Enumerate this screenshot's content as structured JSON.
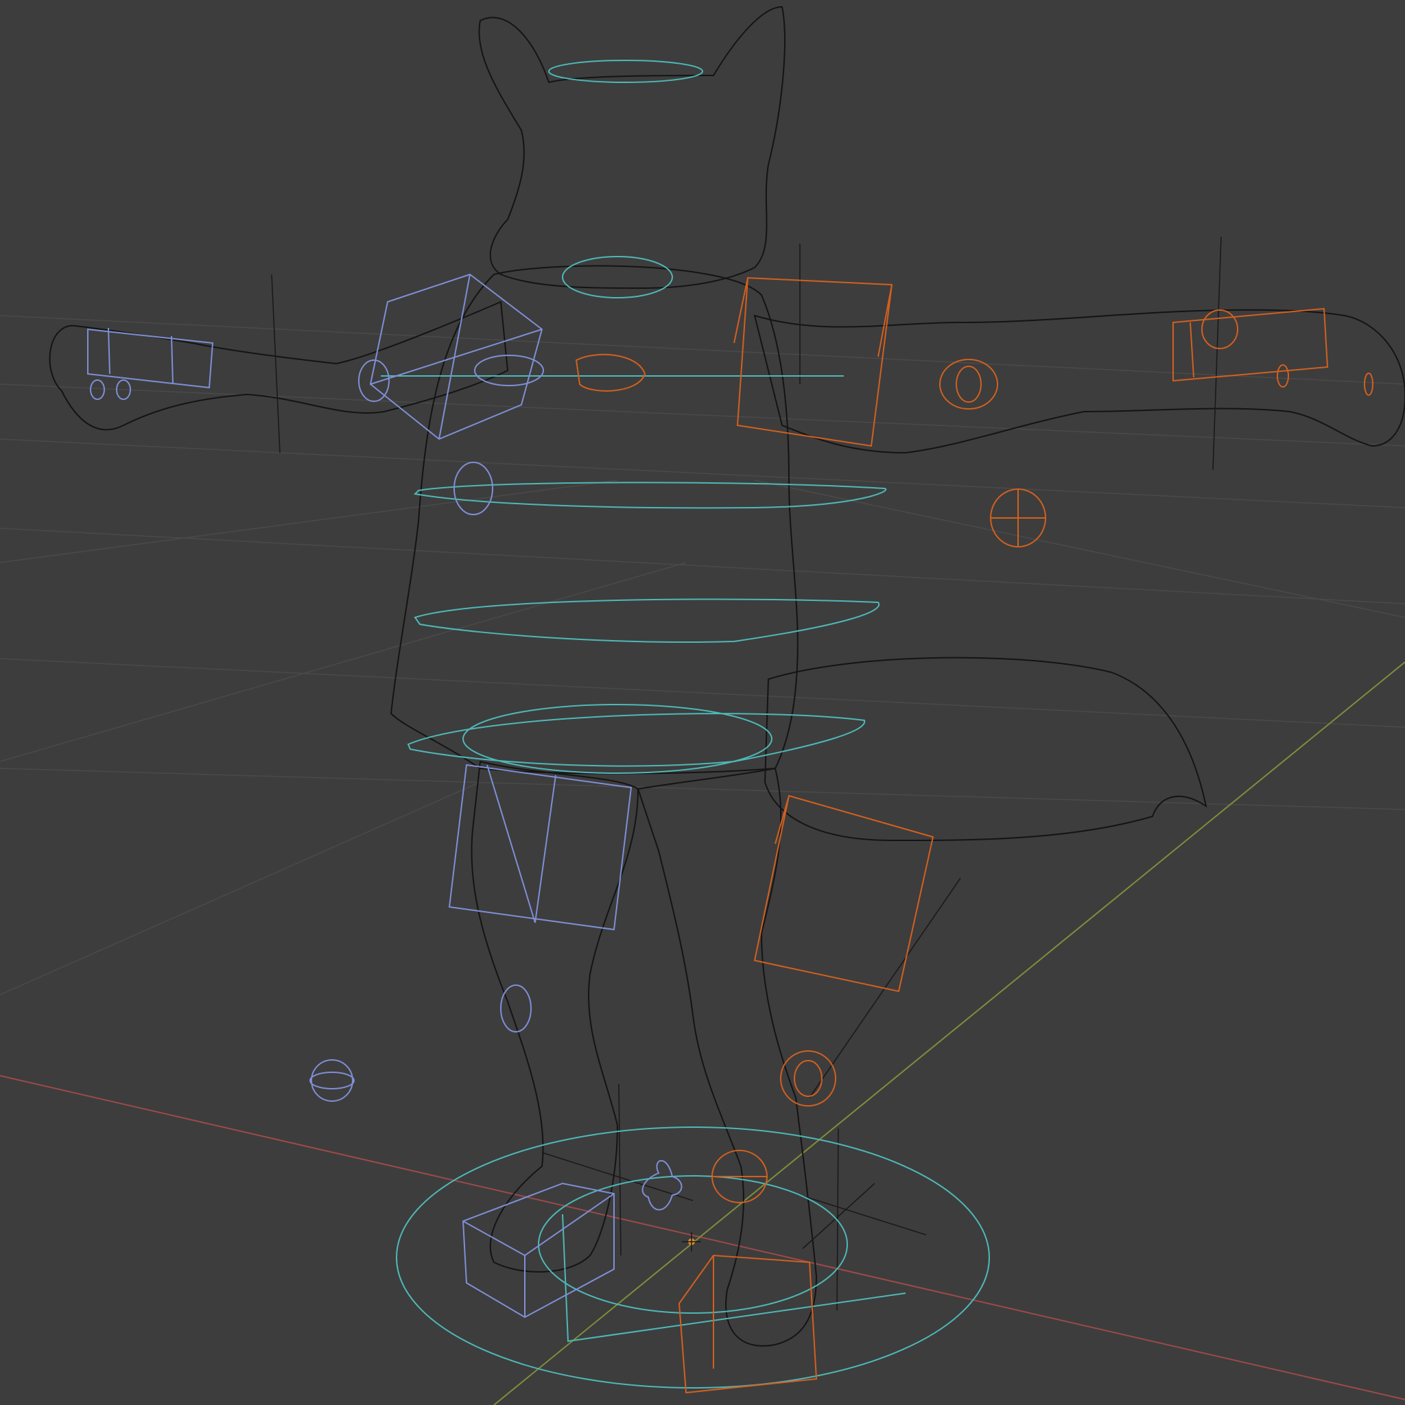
{
  "viewport": {
    "background": "#3d3d3d",
    "grid_color": "#4a4a4a",
    "axis_x_color": "#9c4a4a",
    "axis_y_color": "#7d8f3a"
  },
  "scene": {
    "mesh_wire_color": "#141414",
    "bone_colors": {
      "center": "#4fb8b8",
      "left": "#7f8fd6",
      "right": "#d2601f"
    },
    "icons": [
      "wireframe-fox-mesh-icon",
      "rig-controls-icon",
      "world-origin-icon"
    ]
  }
}
